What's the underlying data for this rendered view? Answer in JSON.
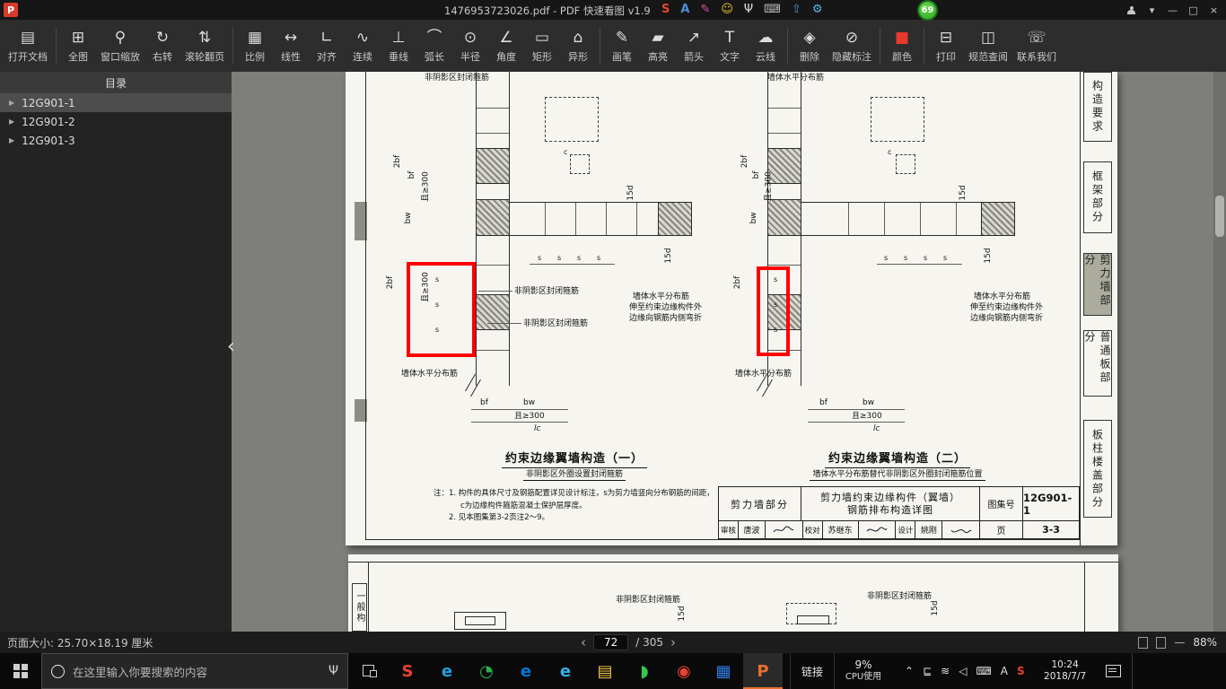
{
  "titlebar": {
    "app_initial": "P",
    "title": "1476953723026.pdf - PDF 快速看图 v1.9",
    "badge": "69",
    "ime": {
      "sogou": "S",
      "a": "A",
      "brush": "✎",
      "smiley": "☺",
      "mic": "Ψ",
      "keyboard": "⌨",
      "up": "⇧",
      "wrench": "⚙"
    },
    "window": {
      "chevron": "▾",
      "minimize": "—",
      "maximize": "□",
      "close": "×"
    }
  },
  "toolbar": {
    "tools": [
      {
        "label": "打开文档",
        "glyph": "▤"
      },
      {
        "label": "全图",
        "glyph": "⊞"
      },
      {
        "label": "窗口缩放",
        "glyph": "⚲"
      },
      {
        "label": "右转",
        "glyph": "↻"
      },
      {
        "label": "滚轮翻页",
        "glyph": "⇅"
      },
      {
        "label": "比例",
        "glyph": "▦"
      },
      {
        "label": "线性",
        "glyph": "↔"
      },
      {
        "label": "对齐",
        "glyph": "∟"
      },
      {
        "label": "连续",
        "glyph": "∿"
      },
      {
        "label": "垂线",
        "glyph": "⊥"
      },
      {
        "label": "弧长",
        "glyph": "⌒"
      },
      {
        "label": "半径",
        "glyph": "⊙"
      },
      {
        "label": "角度",
        "glyph": "∠"
      },
      {
        "label": "矩形",
        "glyph": "▭"
      },
      {
        "label": "异形",
        "glyph": "⌂"
      },
      {
        "label": "画笔",
        "glyph": "✎"
      },
      {
        "label": "高亮",
        "glyph": "▰"
      },
      {
        "label": "箭头",
        "glyph": "↗"
      },
      {
        "label": "文字",
        "glyph": "T"
      },
      {
        "label": "云线",
        "glyph": "☁"
      },
      {
        "label": "删除",
        "glyph": "◈"
      },
      {
        "label": "隐藏标注",
        "glyph": "⊘"
      },
      {
        "label": "颜色",
        "glyph": "■",
        "color": "#e8382c"
      },
      {
        "label": "打印",
        "glyph": "⊟"
      },
      {
        "label": "规范查阅",
        "glyph": "◫"
      },
      {
        "label": "联系我们",
        "glyph": "☏"
      }
    ]
  },
  "sidebar": {
    "header": "目录",
    "arrow": "▶",
    "items": [
      {
        "label": "12G901-1"
      },
      {
        "label": "12G901-2"
      },
      {
        "label": "12G901-3"
      }
    ]
  },
  "viewer": {
    "collapse_arrow": "‹"
  },
  "pdf": {
    "annotation_color": "#ff0000",
    "labels": {
      "closed_stirrup": "非阴影区封闭箍筋",
      "wall_horiz": "墙体水平分布筋",
      "extend_line1": "伸至约束边缘构件外",
      "extend_line2": "边缘向钢筋内侧弯折",
      "dim_2bf": "2bf",
      "dim_bf": "bf",
      "dim_bw": "bw",
      "dim_ge300": "且≥300",
      "dim_lc": "lc",
      "dim_15d": "15d",
      "dim_s": "s",
      "dim_c": "c"
    },
    "d1": {
      "title": "约束边缘翼墙构造（一）",
      "subtitle": "非阴影区外圈设置封闭箍筋"
    },
    "d2": {
      "title": "约束边缘翼墙构造（二）",
      "subtitle": "墙体水平分布筋替代非阴影区外圈封闭箍筋位置"
    },
    "notes": {
      "line1": "注：1. 构件的具体尺寸及钢筋配置详见设计标注，s为剪力墙竖向分布钢筋的间距，",
      "line2": "c为边缘构件箍筋混凝土保护层厚度。",
      "line3": "2. 见本图集第3-2页注2～9。"
    },
    "titleblock": {
      "section": "剪力墙部分",
      "title_line1": "剪力墙约束边缘构件（翼墙）",
      "title_line2": "钢筋排布构造详图",
      "atlas_label": "图集号",
      "atlas_no": "12G901-1",
      "review_label": "审核",
      "review_name": "唐波",
      "check_label": "校对",
      "check_name": "苏继东",
      "design_label": "设计",
      "design_name": "姚刚",
      "page_label": "页",
      "page_no": "3-3"
    },
    "side_tabs": [
      {
        "label": "构造要求"
      },
      {
        "label": "框架部分"
      },
      {
        "label": "剪力墙部分"
      },
      {
        "label": "普通板部分"
      },
      {
        "label": "板柱楼盖部分"
      }
    ],
    "page2": {
      "side_tab": "一般构",
      "label1": "非阴影区封闭箍筋",
      "label2": "非阴影区封闭箍筋",
      "dim_15d": "15d"
    }
  },
  "statusbar": {
    "page_size": "页面大小: 25.70×18.19 厘米",
    "prev": "‹",
    "next": "›",
    "page_current": "72",
    "page_total": "/ 305",
    "minus": "—",
    "zoom": "88%"
  },
  "taskbar": {
    "search_placeholder": "在这里输入你要搜索的内容",
    "mic": "Ψ",
    "links_label": "链接",
    "cpu_percent": "9%",
    "cpu_label": "CPU使用",
    "time": "10:24",
    "date": "2018/7/7",
    "apps": [
      {
        "name": "sogou-browser",
        "glyph": "S",
        "color": "#e8432e"
      },
      {
        "name": "ie",
        "glyph": "e",
        "color": "#1ea0e0"
      },
      {
        "name": "browser-360",
        "glyph": "◔",
        "color": "#2bb24c"
      },
      {
        "name": "edge",
        "glyph": "e",
        "color": "#0078d7"
      },
      {
        "name": "ie-2",
        "glyph": "e",
        "color": "#35b1e8"
      },
      {
        "name": "file-explorer",
        "glyph": "▤",
        "color": "#f2c744"
      },
      {
        "name": "green-app",
        "glyph": "◗",
        "color": "#3cc24f"
      },
      {
        "name": "chrome",
        "glyph": "◉",
        "color": "#e84335"
      },
      {
        "name": "blue-app",
        "glyph": "▦",
        "color": "#2f7ce8"
      },
      {
        "name": "pdf-viewer",
        "glyph": "P",
        "color": "#e8702c"
      }
    ],
    "tray": [
      {
        "name": "chevron-up-icon",
        "glyph": "⌃"
      },
      {
        "name": "ethernet-icon",
        "glyph": "⊑"
      },
      {
        "name": "wifi-icon",
        "glyph": "≋"
      },
      {
        "name": "volume-icon",
        "glyph": "◁"
      },
      {
        "name": "touch-keyboard-icon",
        "glyph": "⌨"
      },
      {
        "name": "ime-mode-icon",
        "glyph": "A"
      },
      {
        "name": "sogou-tray-icon",
        "glyph": "S"
      }
    ]
  }
}
